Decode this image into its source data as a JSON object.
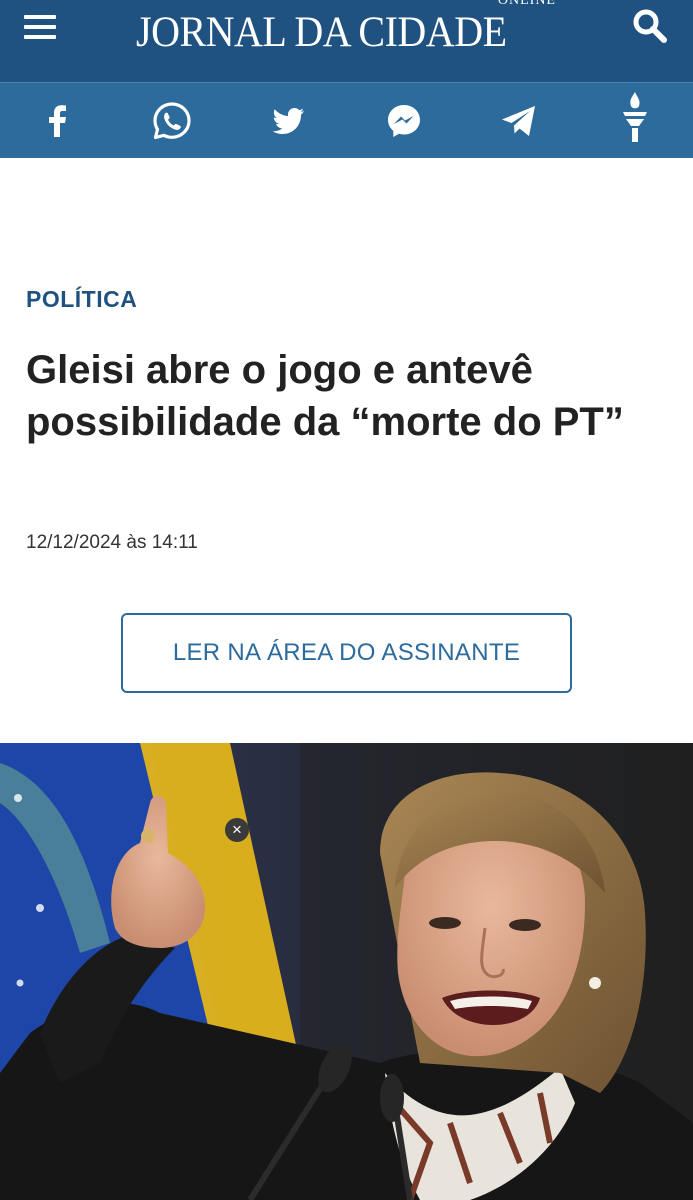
{
  "header": {
    "logo_text": "JORNAL DA CIDADE",
    "logo_subtext": "ONLINE",
    "menu_icon": "hamburger-menu-icon",
    "search_icon": "search-icon",
    "bg_color": "#1f5280"
  },
  "share_bar": {
    "bg_color": "#2c6b9c",
    "icons": [
      "facebook-icon",
      "whatsapp-icon",
      "twitter-icon",
      "messenger-icon",
      "telegram-icon",
      "torch-icon"
    ]
  },
  "article": {
    "category": "POLÍTICA",
    "title": "Gleisi abre o jogo e antevê possibilidade da “morte do PT”",
    "datetime": "12/12/2024 às 14:11",
    "subscriber_button": "LER NA ÁREA DO ASSINANTE",
    "accent_color": "#1f5280"
  },
  "ad": {
    "close_label": "×"
  }
}
